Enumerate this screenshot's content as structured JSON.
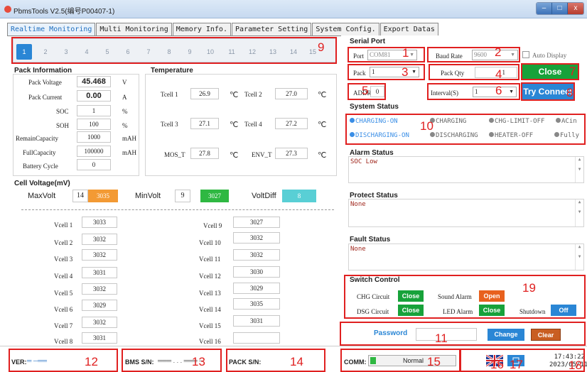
{
  "window": {
    "title": "PbmsTools V2.5(编号P00407-1)",
    "min": "–",
    "max": "□",
    "close": "x"
  },
  "tabs": [
    "Realtime Monitoring",
    "Multi Monitoring",
    "Memory Info.",
    "Parameter Setting",
    "System Config.",
    "Export Datas"
  ],
  "pack_buttons": [
    "1",
    "2",
    "3",
    "4",
    "5",
    "6",
    "7",
    "8",
    "9",
    "10",
    "11",
    "12",
    "13",
    "14",
    "15"
  ],
  "pack_info": {
    "title": "Pack Information",
    "rows": [
      {
        "label": "Pack Voltage",
        "value": "45.468",
        "unit": "V"
      },
      {
        "label": "Pack Current",
        "value": "0.00",
        "unit": "A"
      },
      {
        "label": "SOC",
        "value": "1",
        "unit": "%"
      },
      {
        "label": "SOH",
        "value": "100",
        "unit": "%"
      },
      {
        "label": "RemainCapacity",
        "value": "1000",
        "unit": "mAH"
      },
      {
        "label": "FullCapacity",
        "value": "100000",
        "unit": "mAH"
      },
      {
        "label": "Battery Cycle",
        "value": "0",
        "unit": ""
      }
    ]
  },
  "temperature": {
    "title": "Temperature",
    "unit": "℃",
    "rows": [
      {
        "l1": "Tcell 1",
        "v1": "26.9",
        "l2": "Tcell 2",
        "v2": "27.0"
      },
      {
        "l1": "Tcell 3",
        "v1": "27.1",
        "l2": "Tcell 4",
        "v2": "27.2"
      },
      {
        "l1": "MOS_T",
        "v1": "27.8",
        "l2": "ENV_T",
        "v2": "27.3"
      }
    ]
  },
  "cell_voltage": {
    "title": "Cell Voltage(mV)",
    "max_label": "MaxVolt",
    "max_idx": "14",
    "max_val": "3035",
    "min_label": "MinVolt",
    "min_idx": "9",
    "min_val": "3027",
    "diff_label": "VoltDiff",
    "diff_val": "8",
    "left": [
      {
        "label": "Vcell 1",
        "value": "3033"
      },
      {
        "label": "Vcell 2",
        "value": "3032"
      },
      {
        "label": "Vcell 3",
        "value": "3032"
      },
      {
        "label": "Vcell 4",
        "value": "3031"
      },
      {
        "label": "Vcell 5",
        "value": "3032"
      },
      {
        "label": "Vcell 6",
        "value": "3029"
      },
      {
        "label": "Vcell 7",
        "value": "3032"
      },
      {
        "label": "Vcell 8",
        "value": "3031"
      }
    ],
    "right": [
      {
        "label": "Vcell 9",
        "value": "3027"
      },
      {
        "label": "Vcell 10",
        "value": "3032"
      },
      {
        "label": "Vcell 11",
        "value": "3032"
      },
      {
        "label": "Vcell 12",
        "value": "3030"
      },
      {
        "label": "Vcell 13",
        "value": "3029"
      },
      {
        "label": "Vcell 14",
        "value": "3035"
      },
      {
        "label": "Vcell 15",
        "value": "3031"
      },
      {
        "label": "Vcell 16",
        "value": ""
      }
    ]
  },
  "serial": {
    "title": "Serial Port",
    "port_label": "Port",
    "port_value": "COM81",
    "baud_label": "Baud Rate",
    "baud_value": "9600",
    "auto_display": "Auto Display",
    "pack_label": "Pack",
    "pack_value": "1",
    "packqty_label": "Pack Qty",
    "packqty_value": "1",
    "close_btn": "Close",
    "addr_label": "ADDR",
    "addr_value": "0",
    "interval_label": "Interval(S)",
    "interval_value": "1",
    "try_btn": "Try Connect"
  },
  "system_status": {
    "title": "System Status",
    "items": [
      {
        "text": "CHARGING-ON",
        "color": "#3a8ee6",
        "active": true
      },
      {
        "text": "CHARGING",
        "color": "#888888",
        "active": false
      },
      {
        "text": "CHG-LIMIT-OFF",
        "color": "#888888",
        "active": false
      },
      {
        "text": "ACin",
        "color": "#888888",
        "active": false
      },
      {
        "text": "DISCHARGING-ON",
        "color": "#3a8ee6",
        "active": true
      },
      {
        "text": "DISCHARGING",
        "color": "#888888",
        "active": false
      },
      {
        "text": "HEATER-OFF",
        "color": "#888888",
        "active": false
      },
      {
        "text": "Fully",
        "color": "#888888",
        "active": false
      }
    ]
  },
  "alarm": {
    "title": "Alarm Status",
    "text": "SOC Low"
  },
  "protect": {
    "title": "Protect Status",
    "text": "None"
  },
  "fault": {
    "title": "Fault Status",
    "text": "None"
  },
  "switch": {
    "title": "Switch Control",
    "chg_label": "CHG Circuit",
    "chg_btn": "Close",
    "sound_label": "Sound Alarm",
    "sound_btn": "Open",
    "dsg_label": "DSG Circuit",
    "dsg_btn": "Close",
    "led_label": "LED Alarm",
    "led_btn": "Close",
    "shutdown_label": "Shutdown",
    "shutdown_btn": "Off"
  },
  "password": {
    "label": "Password",
    "value": "",
    "change_btn": "Change",
    "clear_btn": "Clear"
  },
  "footer": {
    "ver_label": "VER:",
    "ver_value": "═ ─══",
    "bms_label": "BMS S/N:",
    "bms_value": "═══ . . . ═══ ─",
    "pack_label": "PACK S/N:",
    "comm_label": "COMM:",
    "comm_status": "Normal",
    "time": "17:43:22",
    "date": "2023/05/11"
  },
  "annotations": [
    "1",
    "2",
    "3",
    "4",
    "5",
    "6",
    "7",
    "8",
    "9",
    "10",
    "11",
    "12",
    "13",
    "14",
    "15",
    "16",
    "17",
    "18",
    "19"
  ],
  "colors": {
    "accent_blue": "#2a86d5",
    "green_btn": "#17a23a",
    "orange_btn": "#e8611e",
    "red_marker": "#e02020"
  }
}
